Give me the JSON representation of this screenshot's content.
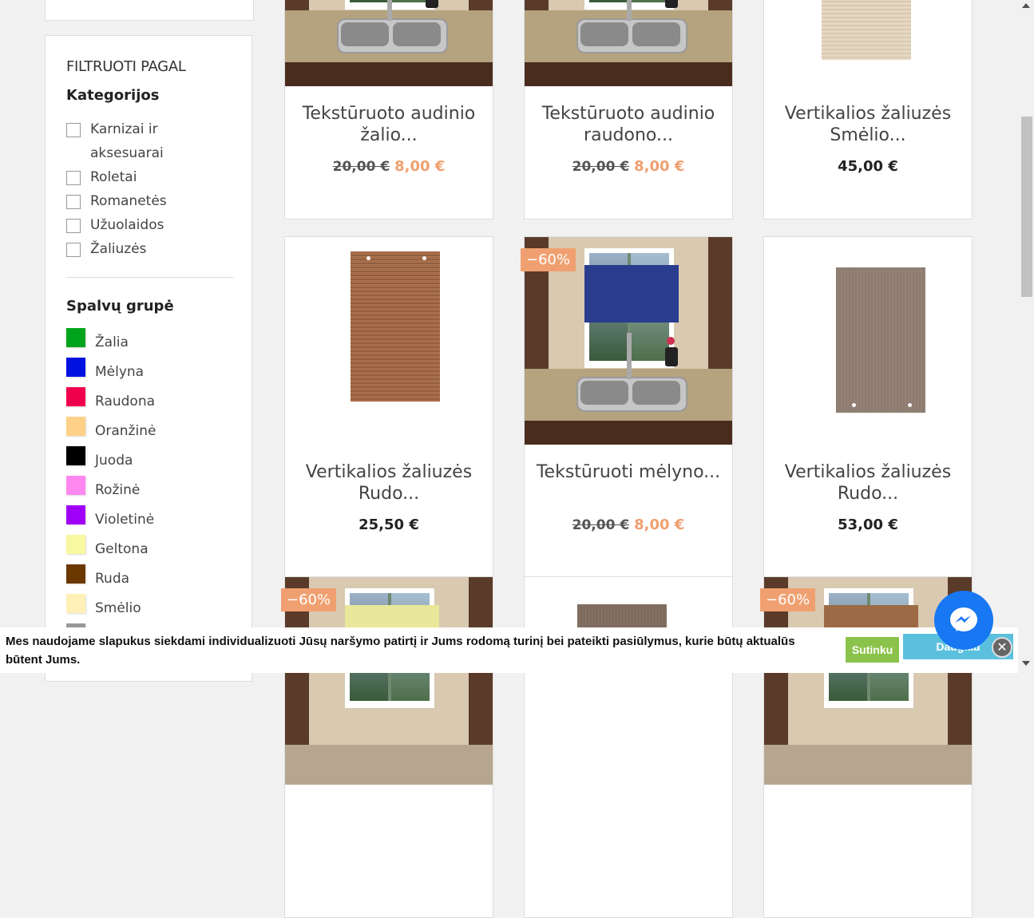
{
  "sidebar": {
    "filter_title": "FILTRUOTI PAGAL",
    "categories_title": "Kategorijos",
    "categories": [
      {
        "label": "Karnizai ir aksesuarai"
      },
      {
        "label": "Roletai"
      },
      {
        "label": "Romanetės"
      },
      {
        "label": "Užuolaidos"
      },
      {
        "label": "Žaliuzės"
      }
    ],
    "color_title": "Spalvų grupė",
    "colors": [
      {
        "label": "Žalia",
        "hex": "#00a41c"
      },
      {
        "label": "Mėlyna",
        "hex": "#0012e0"
      },
      {
        "label": "Raudona",
        "hex": "#f0004c"
      },
      {
        "label": "Oranžinė",
        "hex": "#ffd088"
      },
      {
        "label": "Juoda",
        "hex": "#000000"
      },
      {
        "label": "Rožinė",
        "hex": "#ff88f0"
      },
      {
        "label": "Violetinė",
        "hex": "#a000f8"
      },
      {
        "label": "Geltona",
        "hex": "#f8f8a0"
      },
      {
        "label": "Ruda",
        "hex": "#6a3800"
      },
      {
        "label": "Smėlio",
        "hex": "#fff0b8"
      }
    ]
  },
  "products": [
    {
      "title": "Tekstūruoto audinio žalio...",
      "old_price": "20,00 €",
      "new_price": "8,00 €",
      "price": ""
    },
    {
      "title": "Tekstūruoto audinio raudono...",
      "old_price": "20,00 €",
      "new_price": "8,00 €",
      "price": ""
    },
    {
      "title": "Vertikalios žaliuzės Smėlio...",
      "old_price": "",
      "new_price": "",
      "price": "45,00 €"
    },
    {
      "title": "Vertikalios žaliuzės Rudo...",
      "old_price": "",
      "new_price": "",
      "price": "25,50 €"
    },
    {
      "title": "Tekstūruoti mėlyno...",
      "old_price": "20,00 €",
      "new_price": "8,00 €",
      "price": "",
      "badge": "−60%"
    },
    {
      "title": "Vertikalios žaliuzės Rudo...",
      "old_price": "",
      "new_price": "",
      "price": "53,00 €"
    },
    {
      "badge": "−60%"
    },
    {},
    {
      "badge": "−60%"
    }
  ],
  "cookie": {
    "text": "Mes naudojame slapukus siekdami individualizuoti Jūsų naršymo patirtį ir Jums rodomą turinį bei pateikti pasiūlymus, kurie būtų aktualūs būtent Jums.",
    "agree_label": "Sutinku",
    "more_label": "Daugiau",
    "close_icon": "close-icon"
  },
  "colors": {
    "accent_price": "#f0a070",
    "agree_btn": "#8bc34a",
    "more_btn": "#5bc0de",
    "messenger": "#1877f2"
  }
}
